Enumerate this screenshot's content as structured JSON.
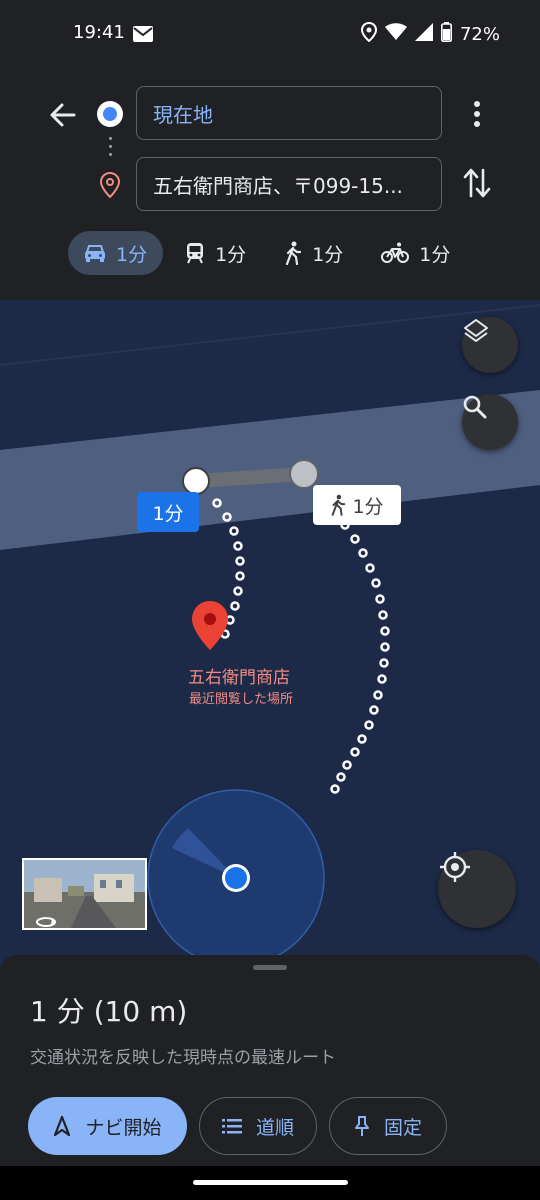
{
  "status": {
    "time": "19:41",
    "battery": "72%"
  },
  "route": {
    "origin": "現在地",
    "destination": "五右衛門商店、〒099-15..."
  },
  "modes": [
    {
      "icon": "car-icon",
      "label": "1分"
    },
    {
      "icon": "transit-icon",
      "label": "1分"
    },
    {
      "icon": "walk-icon",
      "label": "1分"
    },
    {
      "icon": "bike-icon",
      "label": "1分"
    }
  ],
  "map": {
    "car_label": "1分",
    "walk_label": "1分",
    "place_name": "五右衛門商店",
    "place_sub": "最近閲覧した場所"
  },
  "sheet": {
    "duration": "1 分 (10 m)",
    "description": "交通状況を反映した現時点の最速ルート",
    "start_label": "ナビ開始",
    "steps_label": "道順",
    "pin_label": "固定"
  },
  "colors": {
    "accent": "#8ab4f8",
    "map_bg": "#1c2a48",
    "pin": "#ea4335",
    "route_blue": "#1a73e8"
  }
}
